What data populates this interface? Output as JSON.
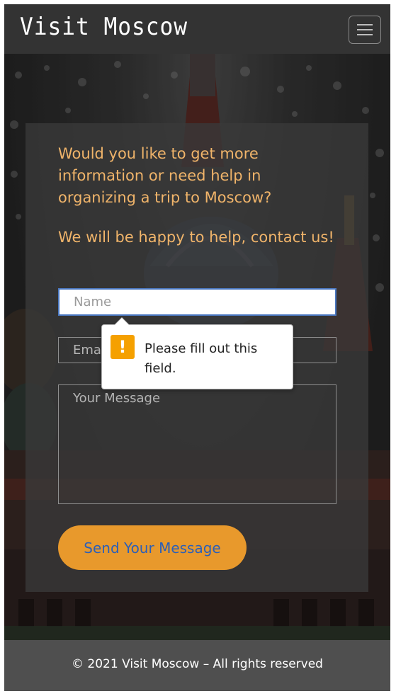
{
  "navbar": {
    "brand": "Visit Moscow",
    "menu_icon": "hamburger-menu-icon"
  },
  "contact": {
    "intro_question": "Would you like to get more information or need help in organizing a trip to Moscow?",
    "intro_offer": "We will be happy to help, contact us!",
    "name_placeholder": "Name",
    "email_placeholder": "Email",
    "message_placeholder": "Your Message",
    "send_label": "Send Your Message"
  },
  "validation": {
    "icon": "warning-icon",
    "message": "Please fill out this field."
  },
  "footer": {
    "text": "© 2021 Visit Moscow – All rights reserved"
  },
  "colors": {
    "accent": "#e8992c",
    "intro_text": "#f0b46a",
    "button_text": "#2b5fb8",
    "navbar": "#333333",
    "footer": "#4f4f4f"
  }
}
